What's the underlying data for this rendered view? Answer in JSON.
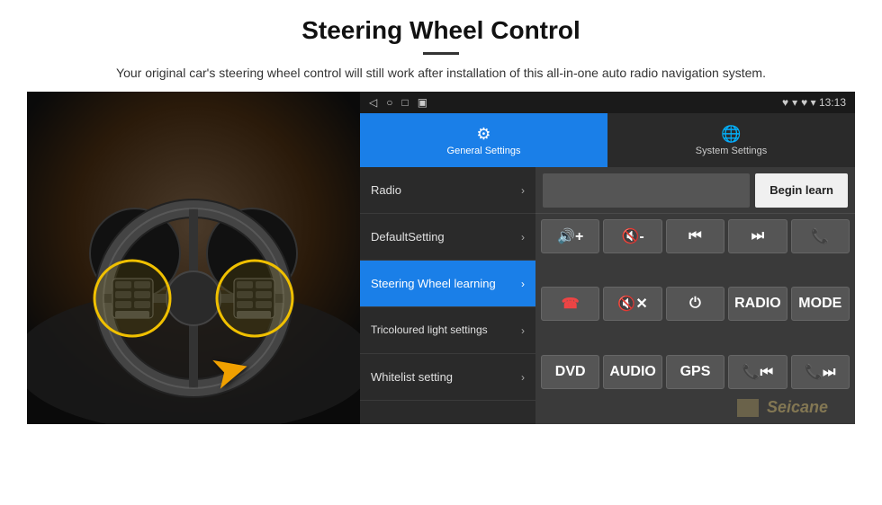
{
  "page": {
    "title": "Steering Wheel Control",
    "subtitle_divider": "—",
    "description": "Your original car's steering wheel control will still work after installation of this all-in-one auto radio navigation system."
  },
  "status_bar": {
    "left_icons": [
      "◁",
      "○",
      "□",
      "▣"
    ],
    "right_info": "♥ ▾ 13:13"
  },
  "tabs": [
    {
      "id": "general",
      "label": "General Settings",
      "icon": "⚙",
      "active": true
    },
    {
      "id": "system",
      "label": "System Settings",
      "icon": "🌐",
      "active": false
    }
  ],
  "menu_items": [
    {
      "id": "radio",
      "label": "Radio",
      "active": false
    },
    {
      "id": "default_setting",
      "label": "DefaultSetting",
      "active": false
    },
    {
      "id": "steering_wheel",
      "label": "Steering Wheel learning",
      "active": true
    },
    {
      "id": "tricoloured",
      "label": "Tricoloured light settings",
      "active": false
    },
    {
      "id": "whitelist",
      "label": "Whitelist setting",
      "active": false
    }
  ],
  "right_panel": {
    "begin_learn_label": "Begin learn",
    "buttons": [
      {
        "id": "vol_up",
        "label": "🔊+",
        "text": "🔊+"
      },
      {
        "id": "vol_down",
        "label": "🔇-",
        "text": "🔇-"
      },
      {
        "id": "prev",
        "label": "⏮",
        "text": "⏮"
      },
      {
        "id": "next",
        "label": "⏭",
        "text": "⏭"
      },
      {
        "id": "phone",
        "label": "📞",
        "text": "📞"
      },
      {
        "id": "hangup",
        "label": "☎",
        "text": "☎"
      },
      {
        "id": "mute",
        "label": "🔇x",
        "text": "🔇✕"
      },
      {
        "id": "power",
        "label": "⏻",
        "text": "⏻"
      },
      {
        "id": "radio_btn",
        "label": "RADIO",
        "text": "RADIO"
      },
      {
        "id": "mode",
        "label": "MODE",
        "text": "MODE"
      },
      {
        "id": "dvd",
        "label": "DVD",
        "text": "DVD"
      },
      {
        "id": "audio",
        "label": "AUDIO",
        "text": "AUDIO"
      },
      {
        "id": "gps",
        "label": "GPS",
        "text": "GPS"
      },
      {
        "id": "tel_prev",
        "label": "📞⏮",
        "text": "📞⏮"
      },
      {
        "id": "tel_next",
        "label": "📞⏭",
        "text": "📞⏭"
      }
    ]
  },
  "watermark": "Seicane"
}
